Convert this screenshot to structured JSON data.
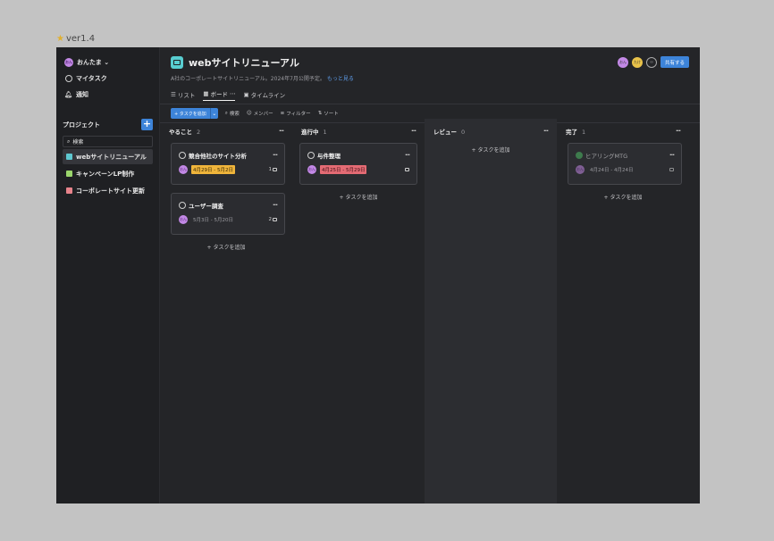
{
  "version": "ver1.4",
  "sidebar": {
    "user_initials": "おん",
    "user_name": "おんたま ⌄",
    "nav": [
      {
        "label": "マイタスク"
      },
      {
        "label": "通知"
      }
    ],
    "projects_heading": "プロジェクト",
    "search_placeholder": "検索",
    "projects": [
      {
        "label": "webサイトリニューアル",
        "color": "#5ec8d0"
      },
      {
        "label": "キャンペーンLP制作",
        "color": "#9bd66c"
      },
      {
        "label": "コーポレートサイト更新",
        "color": "#e7838b"
      }
    ]
  },
  "header": {
    "title": "webサイトリニューアル",
    "description": "A社のコーポレートサイトリニューアル。2024年7月公開予定。",
    "more_link": "もっと見る",
    "share": "共有する",
    "avatars": [
      "おん",
      "たけ"
    ],
    "tabs": [
      {
        "label": "リスト"
      },
      {
        "label": "ボード"
      },
      {
        "label": "タイムライン"
      }
    ]
  },
  "toolbar": {
    "add_task": "+ タスクを追加",
    "search": "検索",
    "members": "メンバー",
    "filter": "フィルター",
    "sort": "ソート"
  },
  "add_task_link": "+ タスクを追加",
  "columns": [
    {
      "name": "やること",
      "count": "2",
      "cards": [
        {
          "title": "競合他社のサイト分析",
          "initials": "おん",
          "date": "4月29日 - 5月2日",
          "date_color": "yellow",
          "comments": "1"
        },
        {
          "title": "ユーザー調査",
          "initials": "おん",
          "date": "5月3日 - 5月20日",
          "date_color": "plain",
          "comments": "2"
        }
      ]
    },
    {
      "name": "進行中",
      "count": "1",
      "cards": [
        {
          "title": "与件整理",
          "initials": "おん",
          "date": "4月25日 - 5月29日",
          "date_color": "red",
          "comments": ""
        }
      ]
    },
    {
      "name": "レビュー",
      "count": "0",
      "cards": []
    },
    {
      "name": "完了",
      "count": "1",
      "cards": [
        {
          "title": "ヒアリングMTG",
          "initials": "おん",
          "date": "4月24日 - 4月24日",
          "date_color": "plain",
          "comments": ""
        }
      ]
    }
  ]
}
